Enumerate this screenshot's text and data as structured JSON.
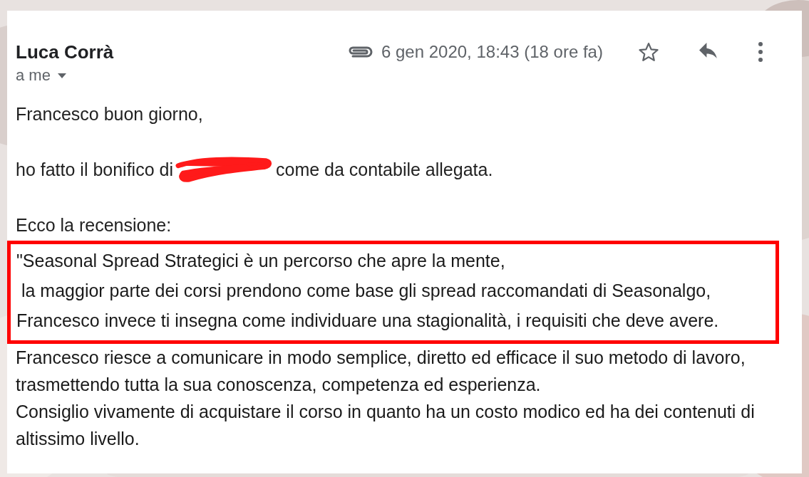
{
  "message": {
    "sender": "Luca Corrà",
    "has_attachment": true,
    "date": "6 gen 2020, 18:43 (18 ore fa)",
    "starred": false,
    "recipient": "a me",
    "body": [
      {
        "kind": "para",
        "text": "Francesco buon giorno,"
      },
      {
        "kind": "redacted",
        "before": "ho fatto il bonifico di",
        "after": "come da contabile allegata."
      },
      {
        "kind": "para",
        "text": "Ecco la recensione:"
      },
      {
        "kind": "highlight",
        "lines": [
          "\"Seasonal Spread Strategici è un percorso che apre la mente,",
          " la maggior parte dei corsi prendono come base gli spread raccomandati di Seasonalgo,",
          "Francesco invece ti insegna come individuare una stagionalità, i requisiti che deve avere."
        ]
      },
      {
        "kind": "review",
        "text": "Francesco riesce a comunicare in modo semplice, diretto ed efficace il suo metodo di lavoro, trasmettendo tutta la sua conoscenza, competenza ed esperienza."
      },
      {
        "kind": "review",
        "text": "Consiglio vivamente di acquistare il corso in quanto ha un costo modico ed ha dei contenuti di altissimo livello."
      }
    ]
  }
}
